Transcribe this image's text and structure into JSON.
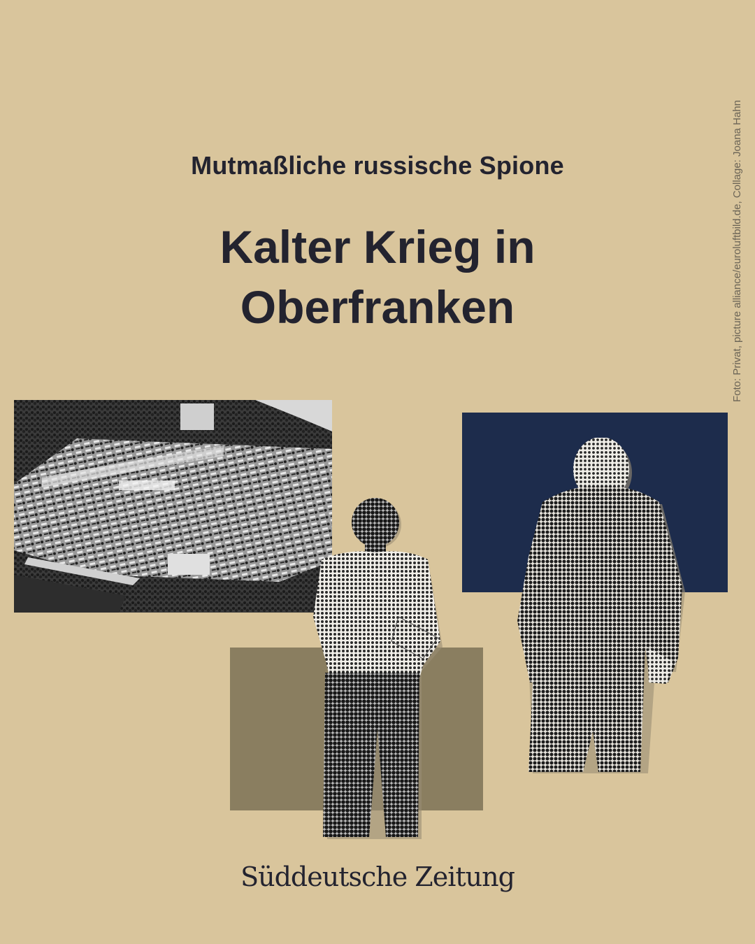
{
  "kicker": "Mutmaßliche russische Spione",
  "headline_line1": "Kalter Krieg in",
  "headline_line2": "Oberfranken",
  "photo_credit": "Foto: Privat, picture alliance/euroluftbild.de, Collage: Joana Hahn",
  "masthead": "Süddeutsche Zeitung",
  "colors": {
    "background": "#d9c59c",
    "text": "#23232f",
    "navy_block": "#1d2c4c",
    "olive_block": "#8a7e60"
  },
  "images": {
    "aerial": "aerial-photo-icon",
    "figure_left": "halftone-man-standing-icon",
    "figure_right": "halftone-man-jacket-icon"
  }
}
